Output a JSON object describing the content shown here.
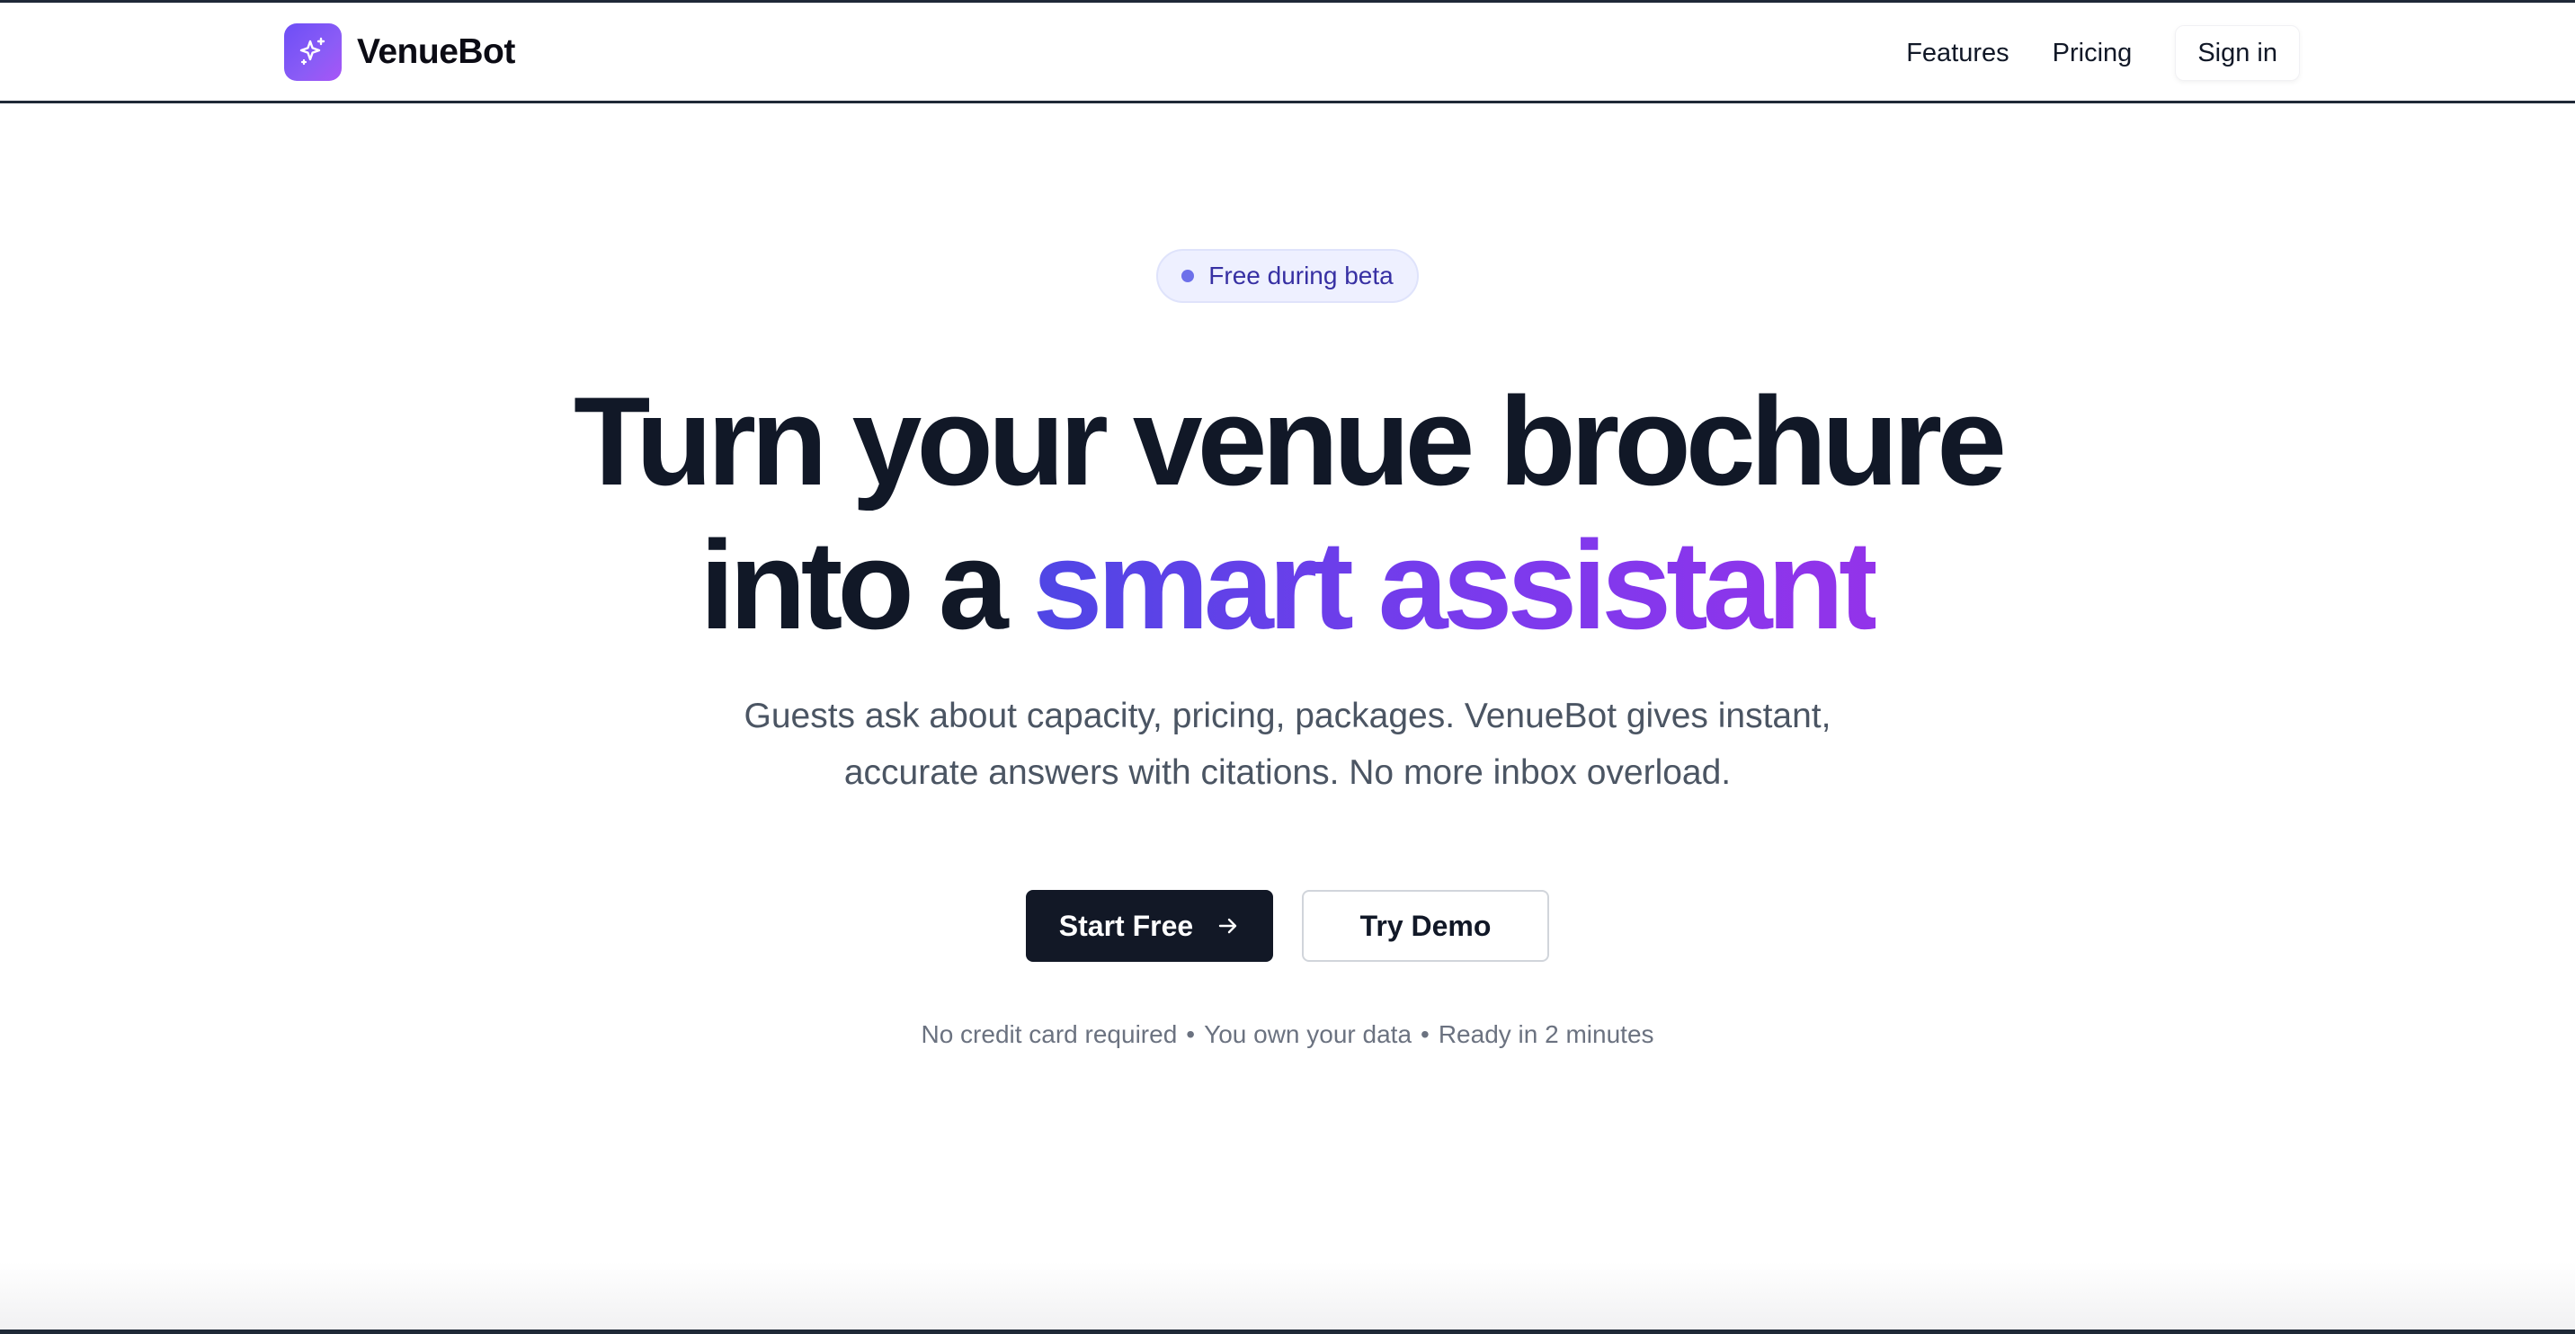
{
  "header": {
    "brand_name": "VenueBot",
    "logo_icon": "sparkles-icon",
    "nav": {
      "features": "Features",
      "pricing": "Pricing",
      "sign_in": "Sign in"
    }
  },
  "hero": {
    "badge": "Free during beta",
    "headline_line1": "Turn your venue brochure",
    "headline_line2_prefix": "into a",
    "headline_line2_accent": "smart assistant",
    "subtitle_line1": "Guests ask about capacity, pricing, packages. VenueBot gives instant,",
    "subtitle_line2": "accurate answers with citations. No more inbox overload.",
    "primary_cta": "Start Free",
    "primary_cta_icon": "arrow-right-icon",
    "secondary_cta": "Try Demo",
    "assurances": [
      "No credit card required",
      "You own your data",
      "Ready in 2 minutes"
    ],
    "separator": "•"
  },
  "colors": {
    "brand_gradient_start": "#6d4ef6",
    "brand_gradient_end": "#a855f7",
    "accent_text_start": "#4f46e5",
    "accent_text_end": "#9333ea",
    "primary_button": "#121826",
    "badge_bg": "#eef0ff",
    "badge_text": "#3730a3"
  }
}
